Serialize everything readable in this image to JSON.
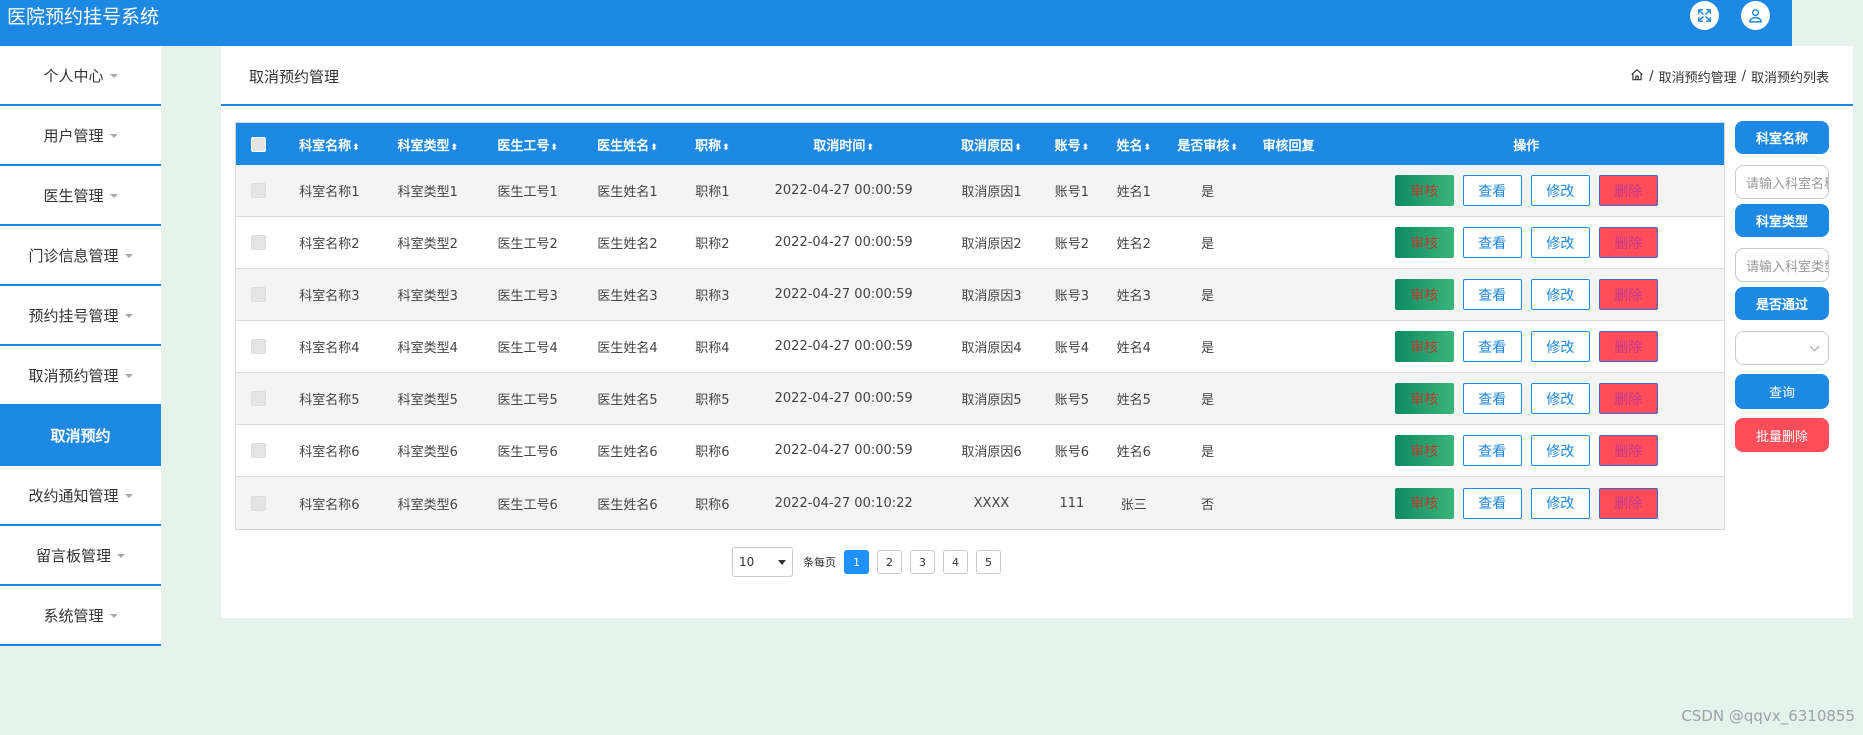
{
  "app": {
    "title": "医院预约挂号系统"
  },
  "header_icons": [
    "fullscreen-icon",
    "user-icon"
  ],
  "sidebar": {
    "items": [
      {
        "label": "个人中心",
        "caret": true,
        "active": false
      },
      {
        "label": "用户管理",
        "caret": true,
        "active": false
      },
      {
        "label": "医生管理",
        "caret": true,
        "active": false
      },
      {
        "label": "门诊信息管理",
        "caret": true,
        "active": false
      },
      {
        "label": "预约挂号管理",
        "caret": true,
        "active": false
      },
      {
        "label": "取消预约管理",
        "caret": true,
        "active": false
      },
      {
        "label": "取消预约",
        "caret": false,
        "active": true
      },
      {
        "label": "改约通知管理",
        "caret": true,
        "active": false
      },
      {
        "label": "留言板管理",
        "caret": true,
        "active": false
      },
      {
        "label": "系统管理",
        "caret": true,
        "active": false
      }
    ]
  },
  "page": {
    "title": "取消预约管理",
    "breadcrumb": [
      "取消预约管理",
      "取消预约列表"
    ],
    "breadcrumb_sep": "/"
  },
  "table": {
    "columns": [
      {
        "key": "dept",
        "label": "科室名称",
        "sortable": true
      },
      {
        "key": "type",
        "label": "科室类型",
        "sortable": true
      },
      {
        "key": "wno",
        "label": "医生工号",
        "sortable": true
      },
      {
        "key": "dname",
        "label": "医生姓名",
        "sortable": true
      },
      {
        "key": "title",
        "label": "职称",
        "sortable": true
      },
      {
        "key": "time",
        "label": "取消时间",
        "sortable": true
      },
      {
        "key": "reason",
        "label": "取消原因",
        "sortable": true
      },
      {
        "key": "acct",
        "label": "账号",
        "sortable": true
      },
      {
        "key": "name",
        "label": "姓名",
        "sortable": true
      },
      {
        "key": "audit",
        "label": "是否审核",
        "sortable": true
      },
      {
        "key": "reply",
        "label": "审核回复",
        "sortable": false
      },
      {
        "key": "ops",
        "label": "操作",
        "sortable": false
      }
    ],
    "sort_glyph": "⬍",
    "rows": [
      {
        "dept": "科室名称1",
        "type": "科室类型1",
        "wno": "医生工号1",
        "dname": "医生姓名1",
        "title": "职称1",
        "time": "2022-04-27 00:00:59",
        "reason": "取消原因1",
        "acct": "账号1",
        "name": "姓名1",
        "audit": "是",
        "reply": ""
      },
      {
        "dept": "科室名称2",
        "type": "科室类型2",
        "wno": "医生工号2",
        "dname": "医生姓名2",
        "title": "职称2",
        "time": "2022-04-27 00:00:59",
        "reason": "取消原因2",
        "acct": "账号2",
        "name": "姓名2",
        "audit": "是",
        "reply": ""
      },
      {
        "dept": "科室名称3",
        "type": "科室类型3",
        "wno": "医生工号3",
        "dname": "医生姓名3",
        "title": "职称3",
        "time": "2022-04-27 00:00:59",
        "reason": "取消原因3",
        "acct": "账号3",
        "name": "姓名3",
        "audit": "是",
        "reply": ""
      },
      {
        "dept": "科室名称4",
        "type": "科室类型4",
        "wno": "医生工号4",
        "dname": "医生姓名4",
        "title": "职称4",
        "time": "2022-04-27 00:00:59",
        "reason": "取消原因4",
        "acct": "账号4",
        "name": "姓名4",
        "audit": "是",
        "reply": ""
      },
      {
        "dept": "科室名称5",
        "type": "科室类型5",
        "wno": "医生工号5",
        "dname": "医生姓名5",
        "title": "职称5",
        "time": "2022-04-27 00:00:59",
        "reason": "取消原因5",
        "acct": "账号5",
        "name": "姓名5",
        "audit": "是",
        "reply": ""
      },
      {
        "dept": "科室名称6",
        "type": "科室类型6",
        "wno": "医生工号6",
        "dname": "医生姓名6",
        "title": "职称6",
        "time": "2022-04-27 00:00:59",
        "reason": "取消原因6",
        "acct": "账号6",
        "name": "姓名6",
        "audit": "是",
        "reply": ""
      },
      {
        "dept": "科室名称6",
        "type": "科室类型6",
        "wno": "医生工号6",
        "dname": "医生姓名6",
        "title": "职称6",
        "time": "2022-04-27 00:10:22",
        "reason": "XXXX",
        "acct": "111",
        "name": "张三",
        "audit": "否",
        "reply": ""
      }
    ],
    "actions": {
      "audit": "审核",
      "view": "查看",
      "edit": "修改",
      "delete": "删除"
    }
  },
  "pagination": {
    "page_size": "10",
    "per_page_label": "条每页",
    "pages": [
      "1",
      "2",
      "3",
      "4",
      "5"
    ],
    "current": "1"
  },
  "filters": {
    "dept_label": "科室名称",
    "dept_placeholder": "请输入科室名称",
    "type_label": "科室类型",
    "type_placeholder": "请输入科室类型",
    "pass_label": "是否通过",
    "pass_value": "",
    "search_button": "查询",
    "batch_delete_button": "批量删除"
  },
  "watermark": "CSDN @qqvx_6310855",
  "colors": {
    "primary": "#1e88e5",
    "danger": "#ff4d5a",
    "audit_green": "#0d8a63"
  }
}
